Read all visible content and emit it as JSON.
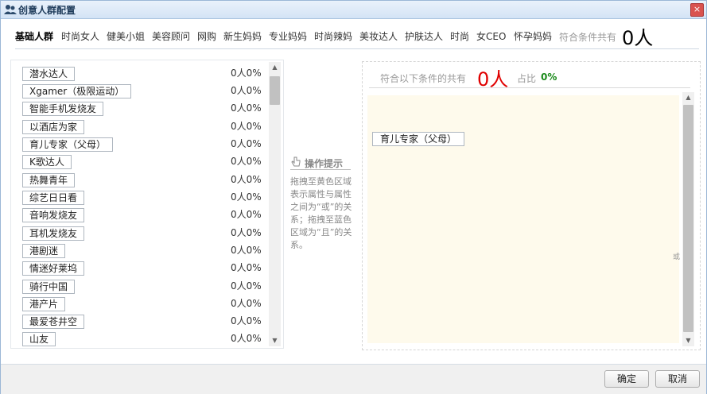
{
  "window": {
    "title": "创意人群配置",
    "close": "×"
  },
  "tabs": [
    {
      "label": "基础人群",
      "active": true
    },
    {
      "label": "时尚女人"
    },
    {
      "label": "健美小姐"
    },
    {
      "label": "美容顾问"
    },
    {
      "label": "网购"
    },
    {
      "label": "新生妈妈"
    },
    {
      "label": "专业妈妈"
    },
    {
      "label": "时尚辣妈"
    },
    {
      "label": "美妆达人"
    },
    {
      "label": "护肤达人"
    },
    {
      "label": "时尚"
    },
    {
      "label": "女CEO"
    },
    {
      "label": "怀孕妈妈"
    }
  ],
  "tabs_total": {
    "label": "符合条件共有",
    "value": "0人"
  },
  "list": {
    "items": [
      {
        "label": "潜水达人",
        "count": "0人",
        "pct": "0%"
      },
      {
        "label": "Xgamer（极限运动）",
        "count": "0人",
        "pct": "0%"
      },
      {
        "label": "智能手机发烧友",
        "count": "0人",
        "pct": "0%"
      },
      {
        "label": "以酒店为家",
        "count": "0人",
        "pct": "0%"
      },
      {
        "label": "育儿专家（父母）",
        "count": "0人",
        "pct": "0%"
      },
      {
        "label": "K歌达人",
        "count": "0人",
        "pct": "0%"
      },
      {
        "label": "热舞青年",
        "count": "0人",
        "pct": "0%"
      },
      {
        "label": "综艺日日看",
        "count": "0人",
        "pct": "0%"
      },
      {
        "label": "音响发烧友",
        "count": "0人",
        "pct": "0%"
      },
      {
        "label": "耳机发烧友",
        "count": "0人",
        "pct": "0%"
      },
      {
        "label": "港剧迷",
        "count": "0人",
        "pct": "0%"
      },
      {
        "label": "情迷好莱坞",
        "count": "0人",
        "pct": "0%"
      },
      {
        "label": "骑行中国",
        "count": "0人",
        "pct": "0%"
      },
      {
        "label": "港产片",
        "count": "0人",
        "pct": "0%"
      },
      {
        "label": "最爱苍井空",
        "count": "0人",
        "pct": "0%"
      },
      {
        "label": "山友",
        "count": "0人",
        "pct": "0%"
      }
    ]
  },
  "hint": {
    "title": "操作提示",
    "text": "拖拽至黄色区域表示属性与属性之间为“或”的关系；拖拽至蓝色区域为“且”的关系。"
  },
  "dropzone": {
    "label": "符合以下条件的共有",
    "count": "0人",
    "ratio_label": "占比",
    "ratio": "0%",
    "selected": "育儿专家（父母）",
    "or_label": "或"
  },
  "footer": {
    "ok": "确定",
    "cancel": "取消"
  }
}
